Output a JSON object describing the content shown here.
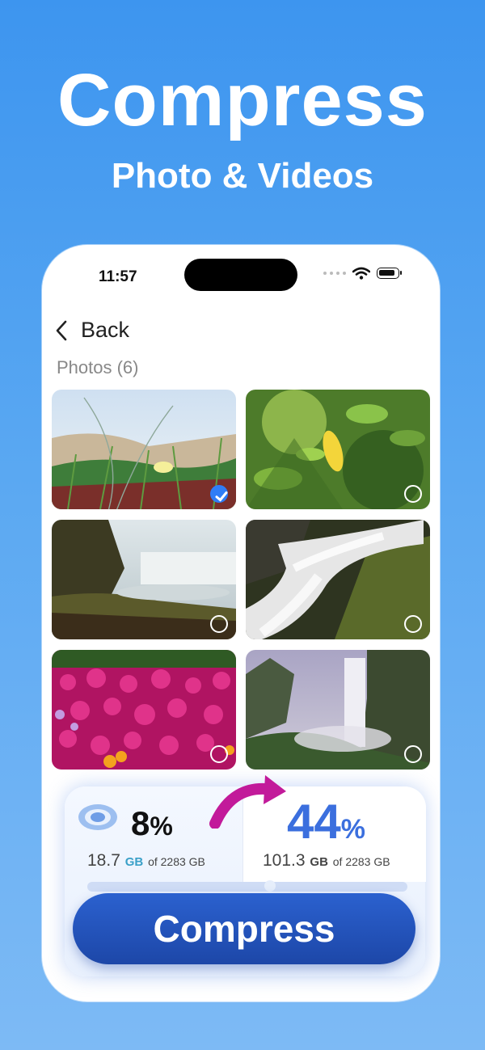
{
  "hero": {
    "title": "Compress",
    "subtitle": "Photo & Videos"
  },
  "status_bar": {
    "time": "11:57"
  },
  "nav": {
    "back_label": "Back"
  },
  "section": {
    "label": "Photos (6)"
  },
  "photos": [
    {
      "name": "grass-flower",
      "selected": true
    },
    {
      "name": "lemon-leaves",
      "selected": false
    },
    {
      "name": "waterfall-cliff",
      "selected": false
    },
    {
      "name": "waterfall-rocks",
      "selected": false
    },
    {
      "name": "pink-flowers",
      "selected": false
    },
    {
      "name": "mountain-waterfall",
      "selected": false
    }
  ],
  "storage": {
    "before_percent": "8",
    "before_percent_unit": "%",
    "before_used": "18.7",
    "before_unit": "GB",
    "before_of": "of 2283 GB",
    "after_percent": "44",
    "after_percent_unit": "%",
    "after_used": "101.3",
    "after_unit": "GB",
    "after_of": "of 2283 GB",
    "slider_fraction": 0.57
  },
  "cta": {
    "label": "Compress"
  },
  "colors": {
    "accent": "#2f7df6",
    "button": "#1d47a8",
    "arrow": "#c21a9a"
  }
}
